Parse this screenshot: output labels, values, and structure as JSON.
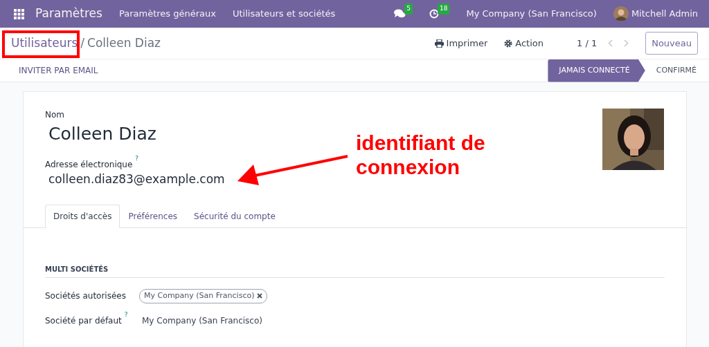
{
  "navbar": {
    "app_name": "Paramètres",
    "menu_items": [
      "Paramètres généraux",
      "Utilisateurs et sociétés"
    ],
    "messages_count": "5",
    "activities_count": "18",
    "company": "My Company (San Francisco)",
    "user": "Mitchell Admin"
  },
  "breadcrumb": {
    "parent": "Utilisateurs",
    "separator": "/",
    "current": "Colleen Diaz"
  },
  "toolbar": {
    "print": "Imprimer",
    "action": "Action",
    "pager": "1 / 1",
    "new_button": "Nouveau"
  },
  "statusbar": {
    "invite_button": "INVITER PAR EMAIL",
    "stages": [
      {
        "label": "JAMAIS CONNECTÉ",
        "selected": true
      },
      {
        "label": "CONFIRMÉ",
        "selected": false
      }
    ]
  },
  "form": {
    "name_label": "Nom",
    "name": "Colleen Diaz",
    "email_label": "Adresse électronique",
    "email_help": "?",
    "email": "colleen.diaz83@example.com",
    "tabs": [
      {
        "label": "Droits d'accès",
        "selected": true
      },
      {
        "label": "Préférences",
        "selected": false
      },
      {
        "label": "Sécurité du compte",
        "selected": false
      }
    ],
    "section_title": "MULTI SOCIÉTÉS",
    "allowed_companies_label": "Sociétés autorisées",
    "allowed_companies": [
      "My Company (San Francisco)"
    ],
    "default_company_label": "Société par défaut",
    "default_company_help": "?",
    "default_company": "My Company (San Francisco)"
  },
  "annotation": {
    "callout": "identifiant de connexion"
  }
}
